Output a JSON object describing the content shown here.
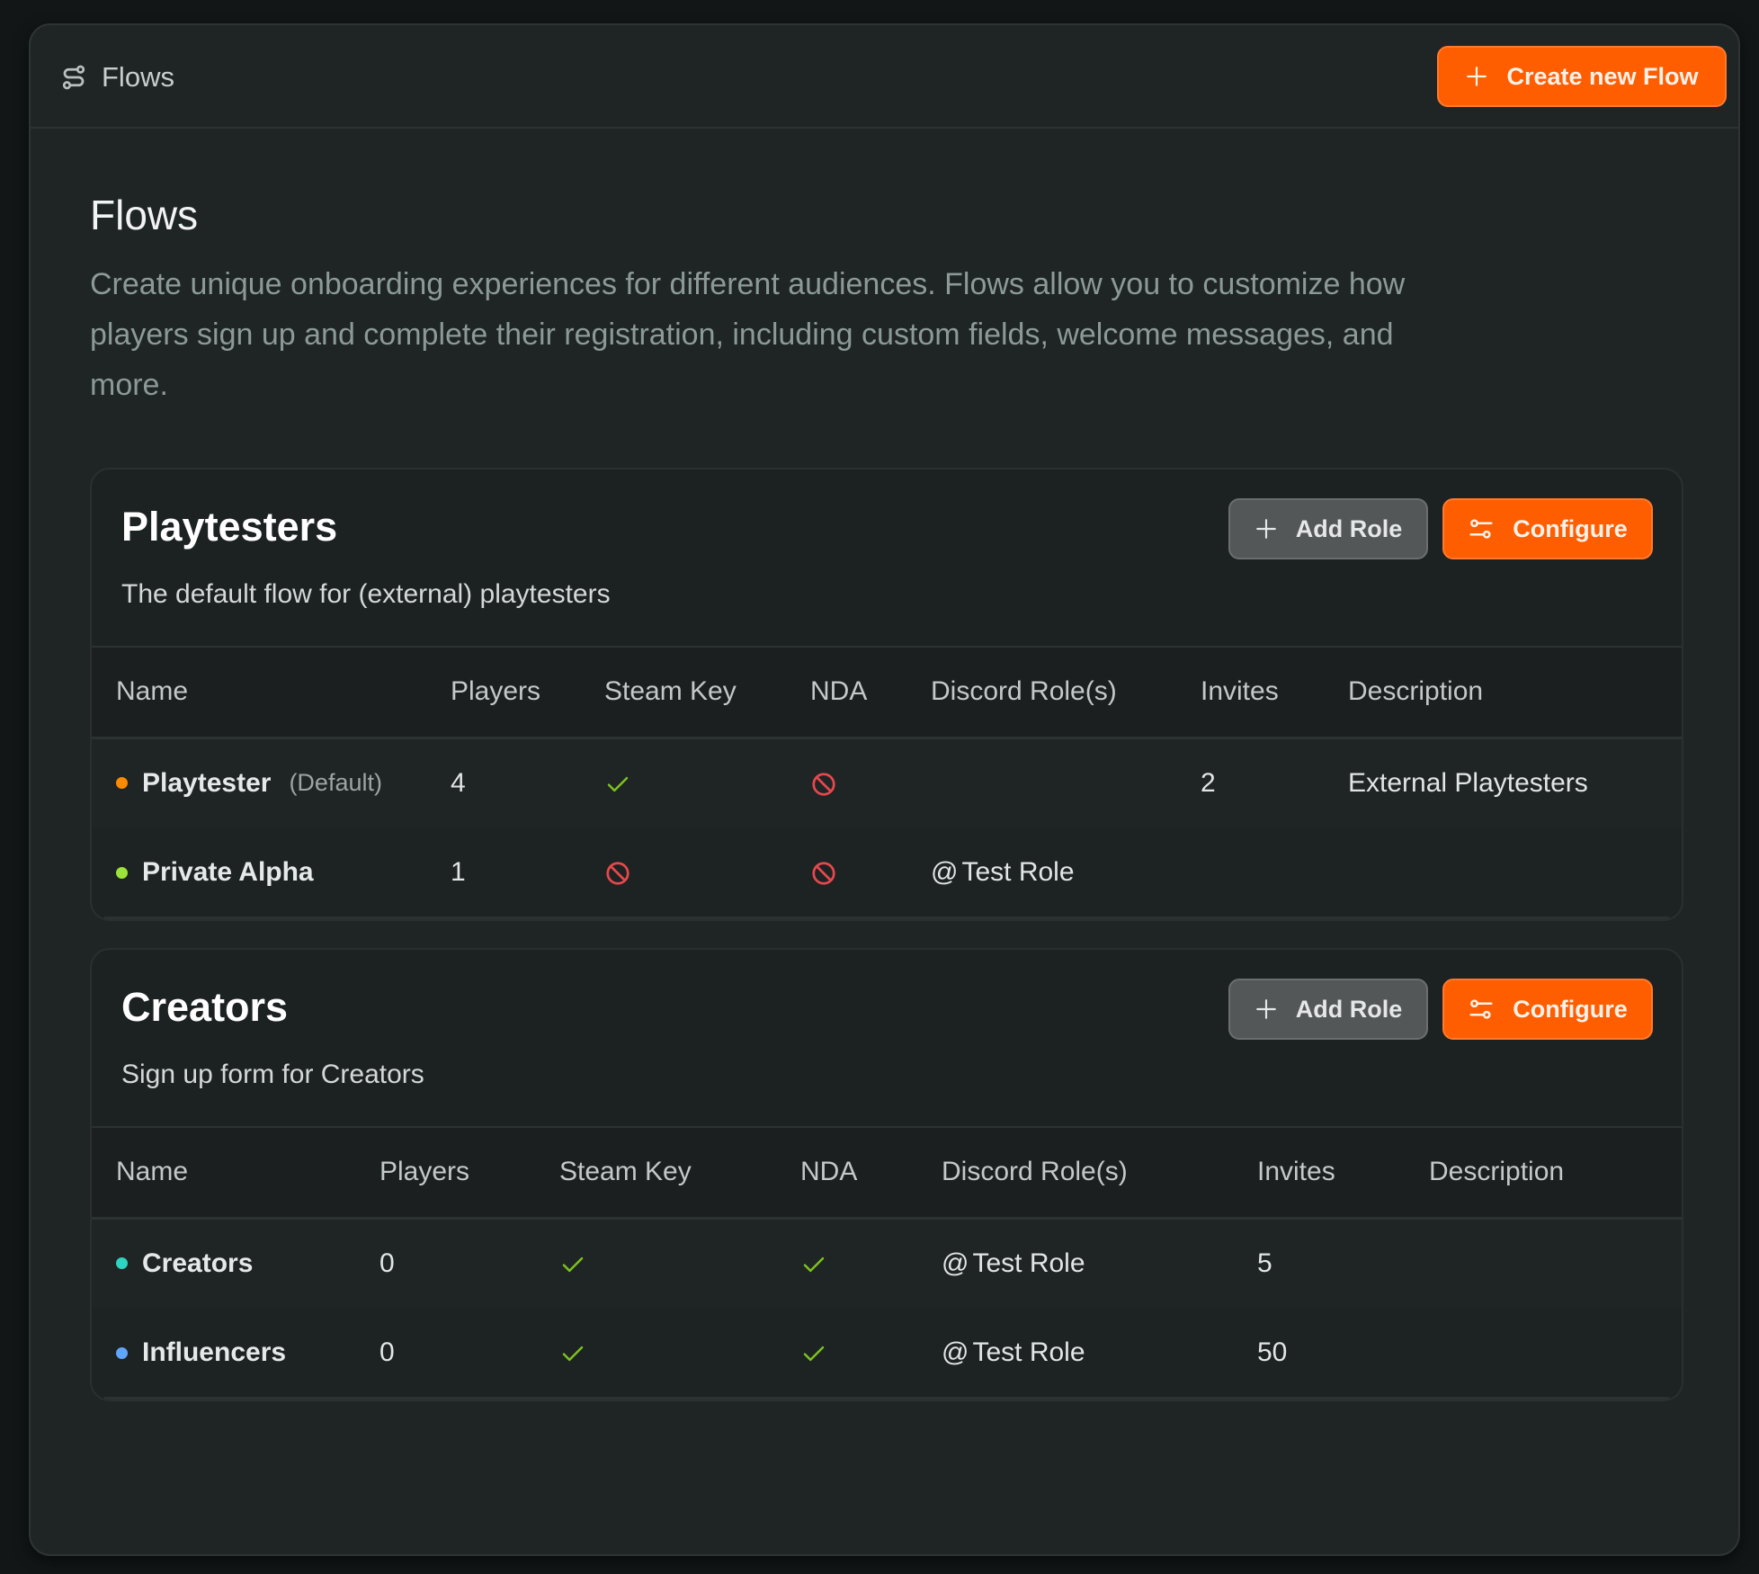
{
  "topbar": {
    "breadcrumb_icon": "flows-icon",
    "breadcrumb_label": "Flows",
    "create_button_label": "Create new Flow",
    "create_button_icon": "plus-icon"
  },
  "page": {
    "title": "Flows",
    "description": "Create unique onboarding experiences for different audiences. Flows allow you to customize how players sign up and complete their registration, including custom fields, welcome messages, and more."
  },
  "colors": {
    "accent": "#ff5e00",
    "check": "#7cc21f",
    "deny": "#e5484d",
    "discord_role": "#f2c318"
  },
  "flows": [
    {
      "title": "Playtesters",
      "subtitle": "The default flow for (external) playtesters",
      "add_role_label": "Add Role",
      "configure_label": "Configure",
      "columns": [
        "Name",
        "Players",
        "Steam Key",
        "NDA",
        "Discord Role(s)",
        "Invites",
        "Description"
      ],
      "roles": [
        {
          "name": "Playtester",
          "tag": "(Default)",
          "dot_color": "#ff8a00",
          "players": "4",
          "steam_key": "check",
          "nda": "deny",
          "discord_role": "",
          "invites": "2",
          "description": "External Playtesters"
        },
        {
          "name": "Private Alpha",
          "tag": "",
          "dot_color": "#9be33a",
          "players": "1",
          "steam_key": "deny",
          "nda": "deny",
          "discord_role": "Test Role",
          "invites": "",
          "description": ""
        }
      ]
    },
    {
      "title": "Creators",
      "subtitle": "Sign up form for Creators",
      "add_role_label": "Add Role",
      "configure_label": "Configure",
      "columns": [
        "Name",
        "Players",
        "Steam Key",
        "NDA",
        "Discord Role(s)",
        "Invites",
        "Description"
      ],
      "roles": [
        {
          "name": "Creators",
          "tag": "",
          "dot_color": "#2dd4bf",
          "players": "0",
          "steam_key": "check",
          "nda": "check",
          "discord_role": "Test Role",
          "invites": "5",
          "description": ""
        },
        {
          "name": "Influencers",
          "tag": "",
          "dot_color": "#60a5fa",
          "players": "0",
          "steam_key": "check",
          "nda": "check",
          "discord_role": "Test Role",
          "invites": "50",
          "description": ""
        }
      ]
    }
  ]
}
